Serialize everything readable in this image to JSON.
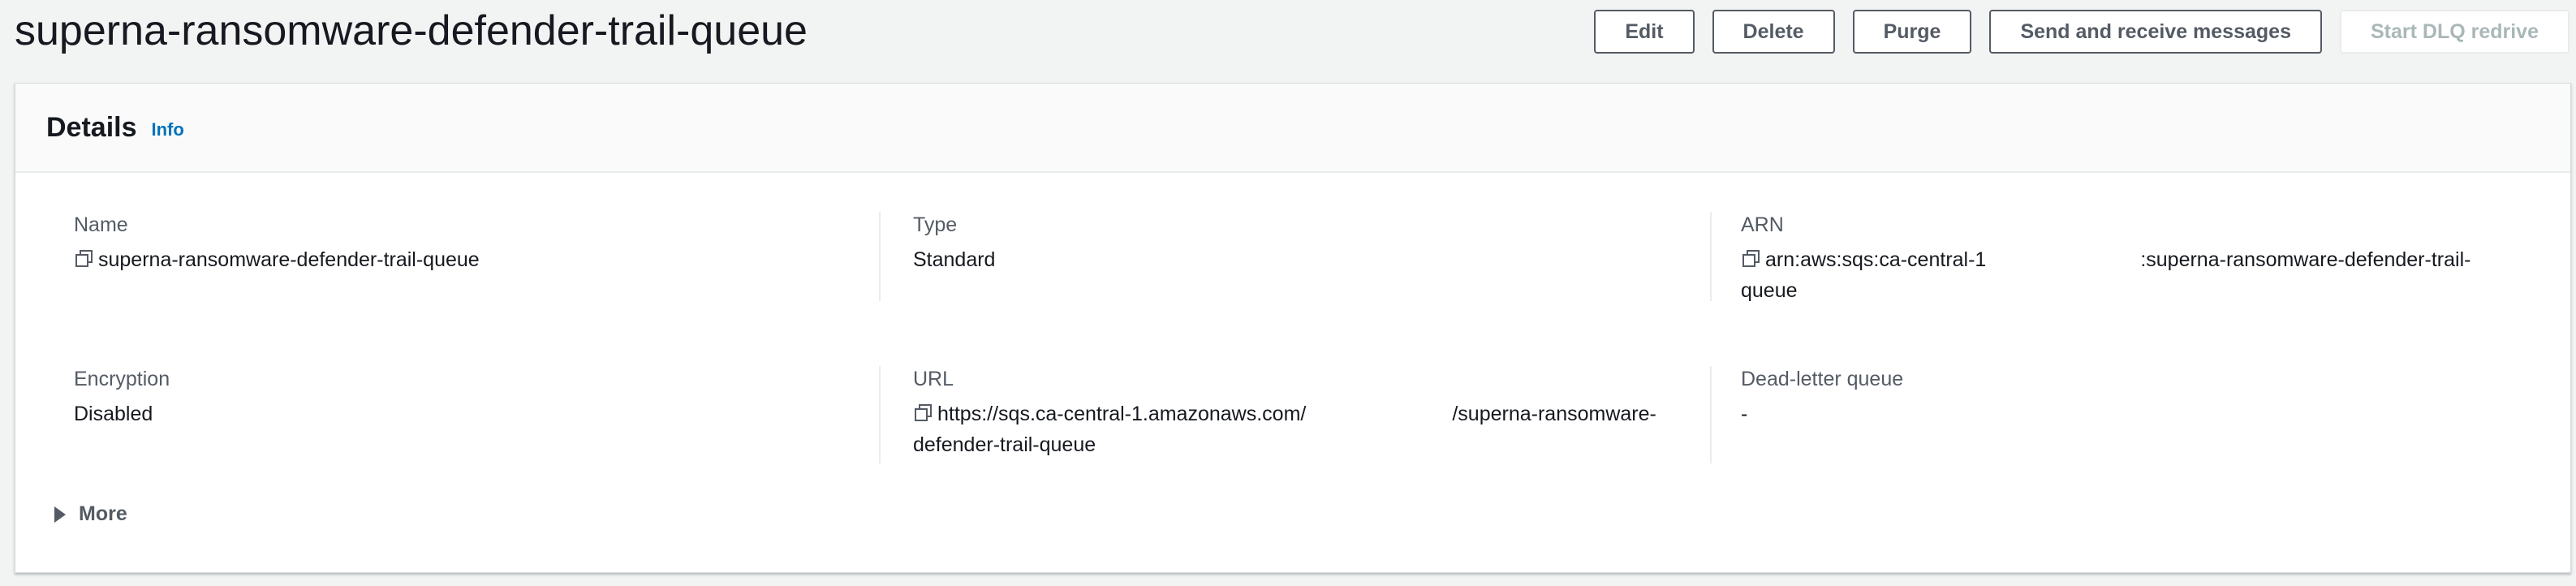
{
  "page": {
    "title": "superna-ransomware-defender-trail-queue"
  },
  "actions": {
    "edit": "Edit",
    "delete": "Delete",
    "purge": "Purge",
    "send_receive": "Send and receive messages",
    "start_dlq_redrive": "Start DLQ redrive"
  },
  "details": {
    "title": "Details",
    "info_link": "Info",
    "name": {
      "label": "Name",
      "value": "superna-ransomware-defender-trail-queue"
    },
    "type": {
      "label": "Type",
      "value": "Standard"
    },
    "arn": {
      "label": "ARN",
      "value_part1": "arn:aws:sqs:ca-central-1",
      "value_part2": ":superna-ransomware-defender-trail-",
      "value_part3": "queue"
    },
    "encryption": {
      "label": "Encryption",
      "value": "Disabled"
    },
    "url": {
      "label": "URL",
      "value_part1": "https://sqs.ca-central-1.amazonaws.com/",
      "value_part2": "/superna-ransomware-",
      "value_part3": "defender-trail-queue"
    },
    "dead_letter_queue": {
      "label": "Dead-letter queue",
      "value": "-"
    },
    "more": "More"
  },
  "colors": {
    "accent": "#0073bb",
    "text": "#16191f",
    "muted": "#545b64"
  },
  "icons": {
    "copy": "copy-icon",
    "expand": "caret-right-icon"
  }
}
